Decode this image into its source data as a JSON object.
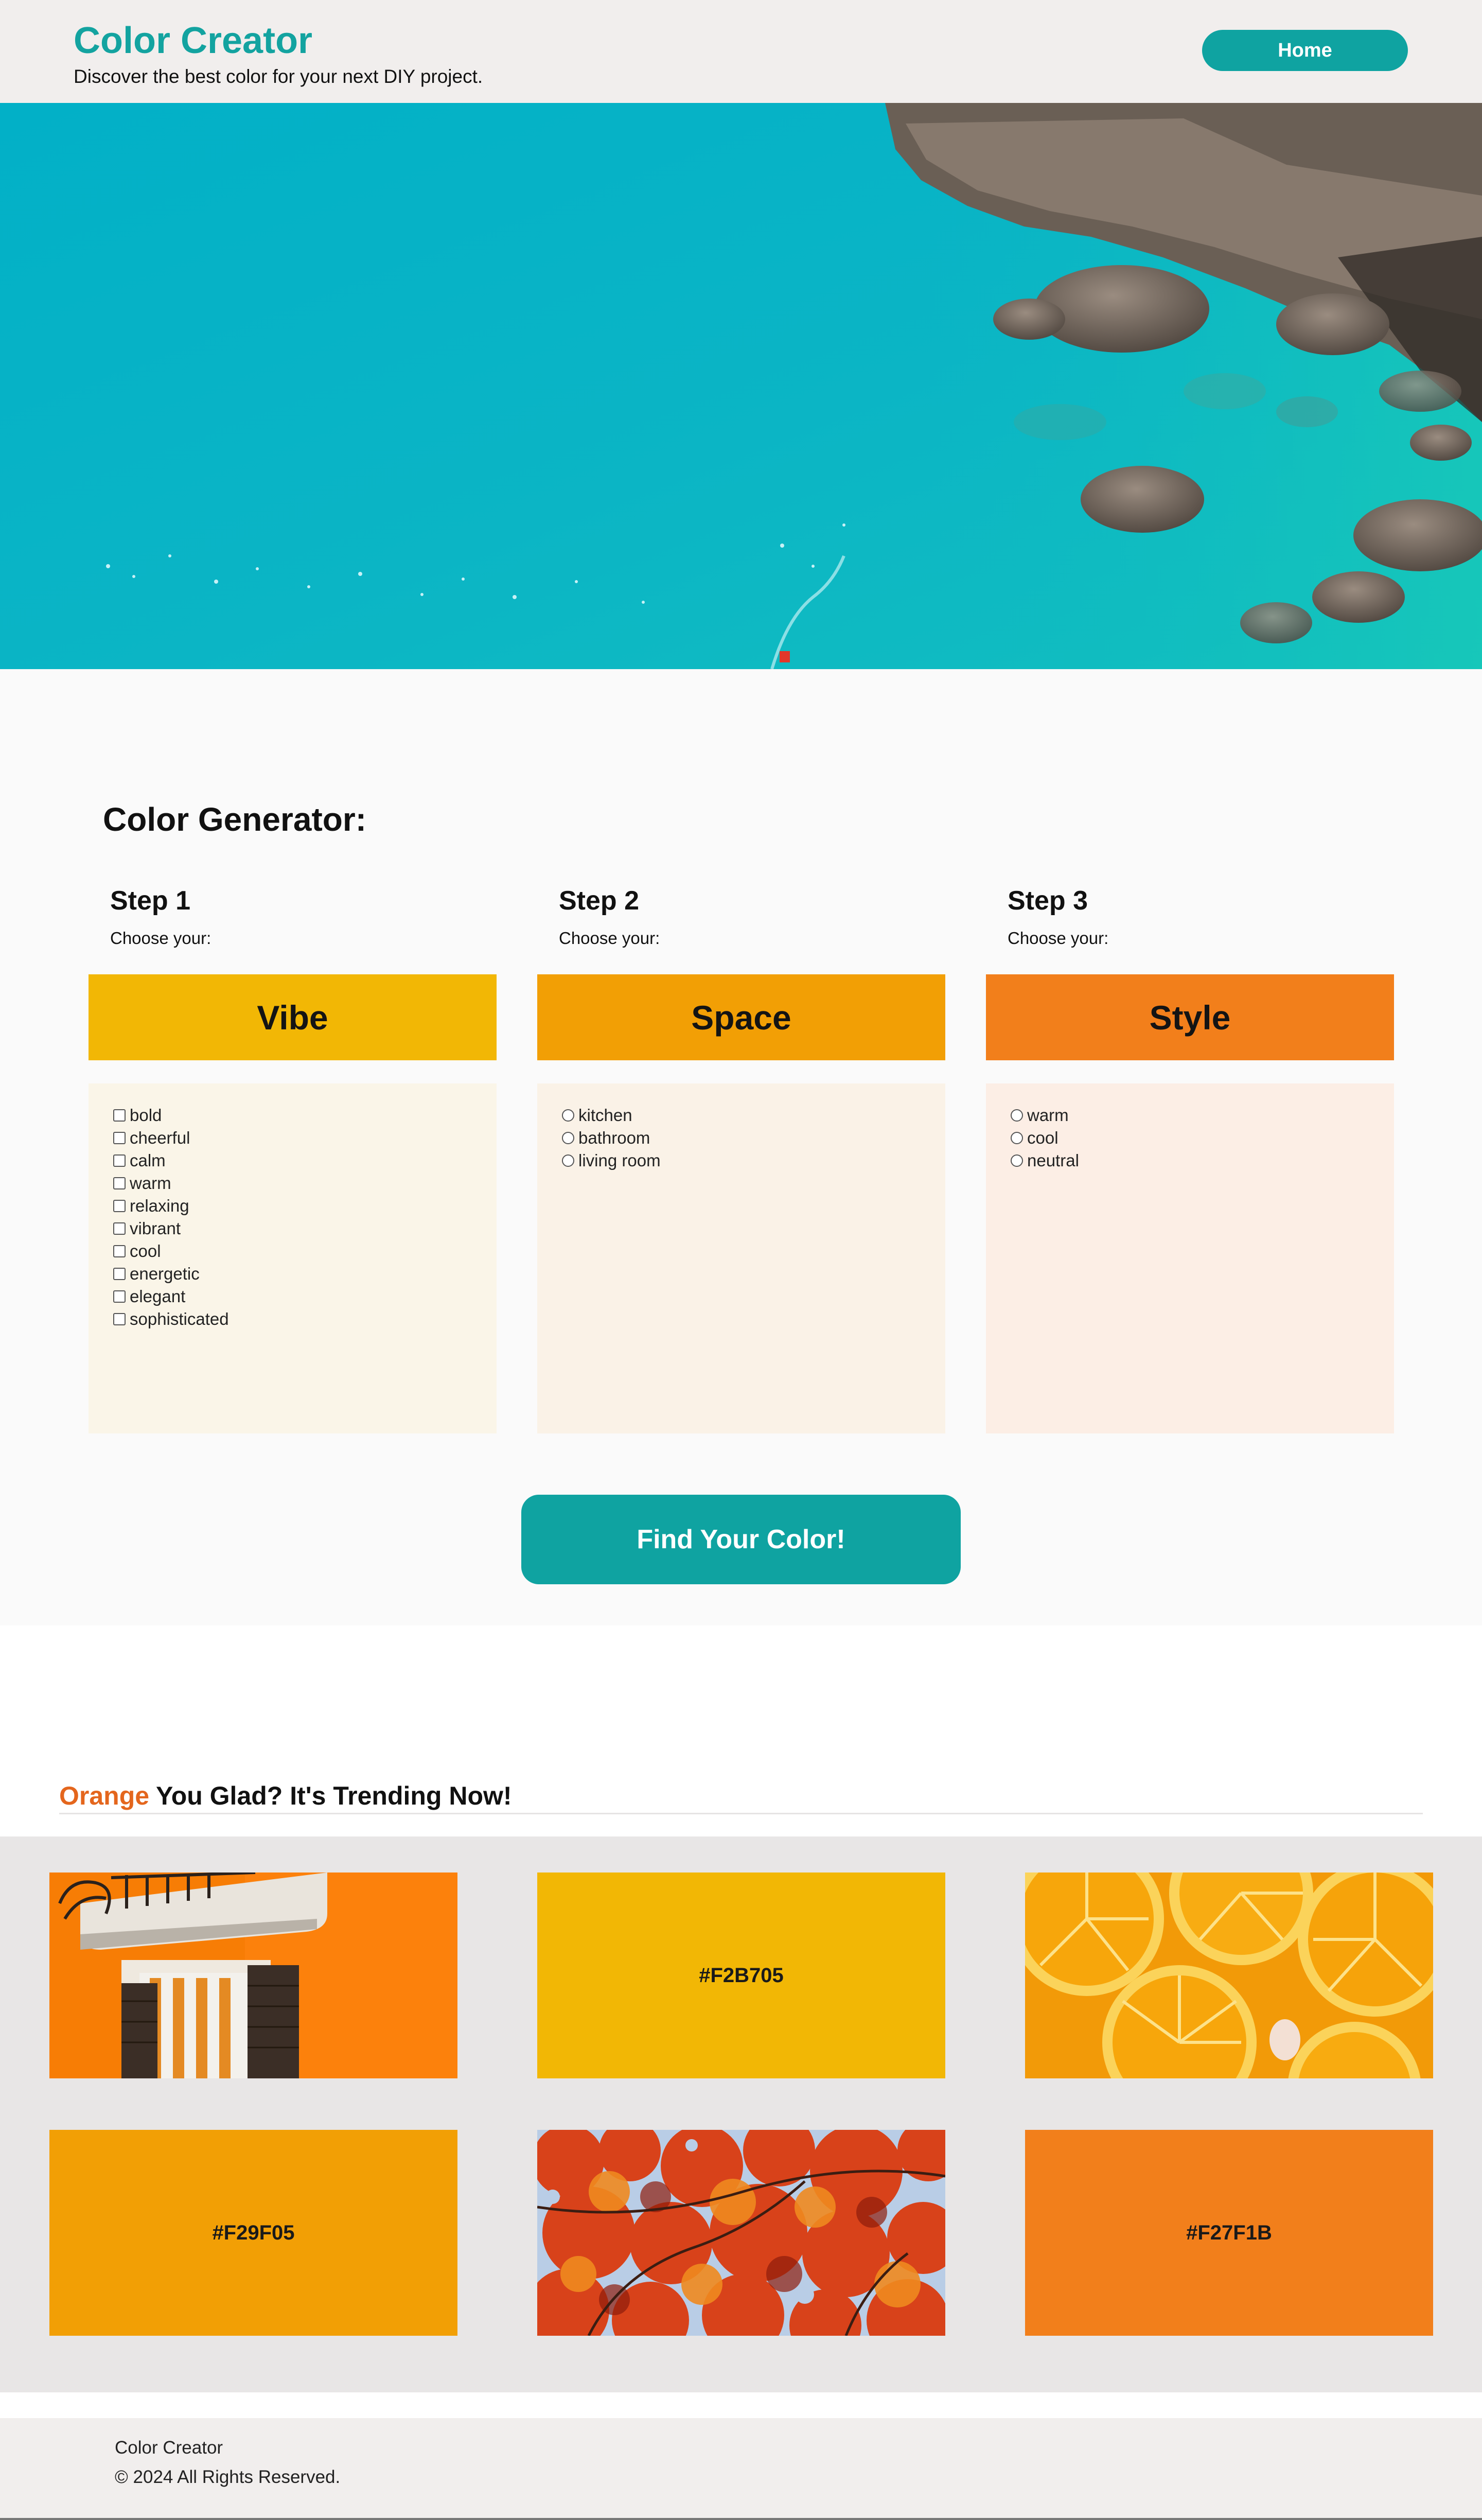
{
  "header": {
    "title": "Color Creator",
    "tagline": "Discover the best color for your next DIY project.",
    "home_label": "Home"
  },
  "hero": {
    "image": "aerial turquoise sea with rocky coastline"
  },
  "generator": {
    "title": "Color Generator:",
    "steps": [
      {
        "heading": "Step 1",
        "subheading": "Choose your:",
        "banner": "Vibe",
        "banner_color": "#F2B705",
        "box_color": "#FAF5E8",
        "input_type": "checkbox",
        "options": [
          "bold",
          "cheerful",
          "calm",
          "warm",
          "relaxing",
          "vibrant",
          "cool",
          "energetic",
          "elegant",
          "sophisticated"
        ]
      },
      {
        "heading": "Step 2",
        "subheading": "Choose your:",
        "banner": "Space",
        "banner_color": "#F29F05",
        "box_color": "#FAF2E7",
        "input_type": "radio",
        "options": [
          "kitchen",
          "bathroom",
          "living room"
        ]
      },
      {
        "heading": "Step 3",
        "subheading": "Choose your:",
        "banner": "Style",
        "banner_color": "#F27F1B",
        "box_color": "#FCEEE5",
        "input_type": "radio",
        "options": [
          "warm",
          "cool",
          "neutral"
        ]
      }
    ],
    "submit_label": "Find Your Color!"
  },
  "trending": {
    "title_accent": "Orange",
    "title_rest": " You Glad? It's Trending Now!",
    "tiles": [
      {
        "kind": "image",
        "image": "orange building facade with balcony and shutters"
      },
      {
        "kind": "swatch",
        "hex": "#F2B705"
      },
      {
        "kind": "image",
        "image": "sliced oranges"
      },
      {
        "kind": "swatch",
        "hex": "#F29F05"
      },
      {
        "kind": "image",
        "image": "red and orange autumn leaves"
      },
      {
        "kind": "swatch",
        "hex": "#F27F1B"
      }
    ]
  },
  "footer": {
    "name": "Color Creator",
    "copyright": "© 2024 All Rights Reserved."
  },
  "colors": {
    "brand_teal": "#0FA3A1",
    "accent_orange": "#E4661D",
    "header_bg": "#F1EEED",
    "grid_bg": "#E8E6E6"
  }
}
